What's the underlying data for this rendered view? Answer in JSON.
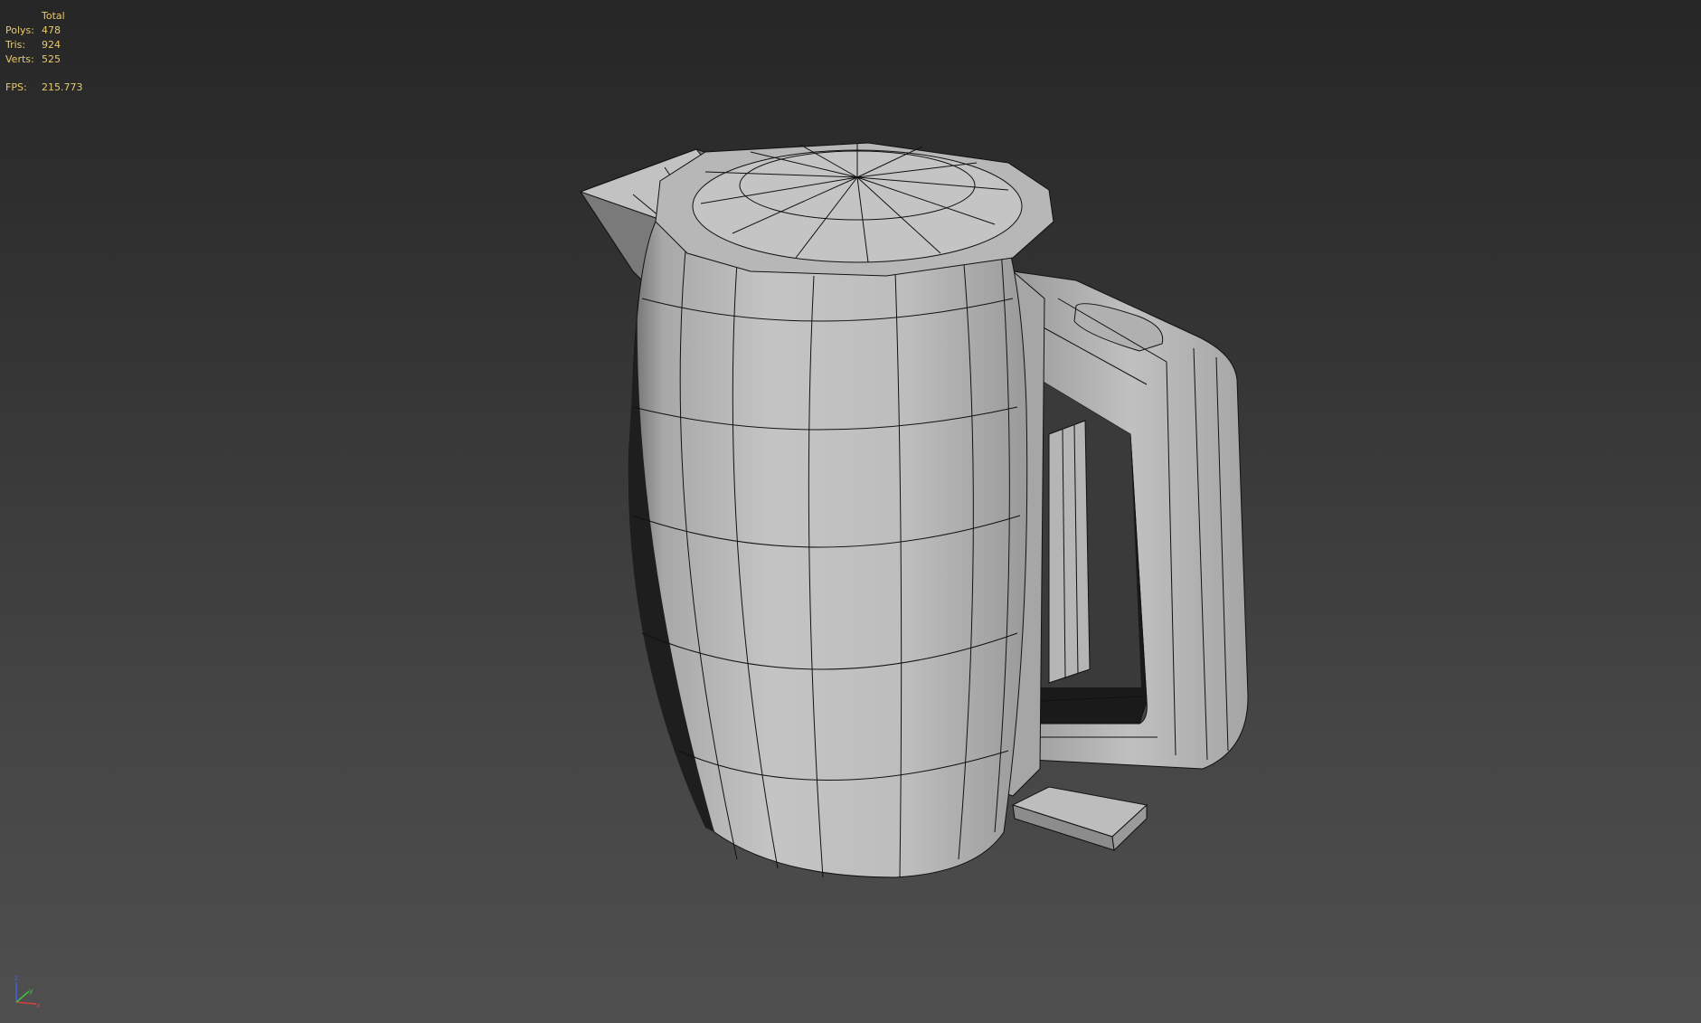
{
  "stats": {
    "header": "Total",
    "rows": [
      {
        "label": "Polys:",
        "value": "478"
      },
      {
        "label": "Tris:",
        "value": "924"
      },
      {
        "label": "Verts:",
        "value": "525"
      }
    ],
    "fps_label": "FPS:",
    "fps_value": "215.773"
  },
  "axis_gizmo": {
    "z": "z",
    "x": "x",
    "y": "y",
    "colors": {
      "x": "#d04040",
      "y": "#40c040",
      "z": "#4060e0"
    }
  },
  "model": {
    "name": "kettle",
    "shading": "#bfbfbf",
    "wire_color": "#111111"
  }
}
